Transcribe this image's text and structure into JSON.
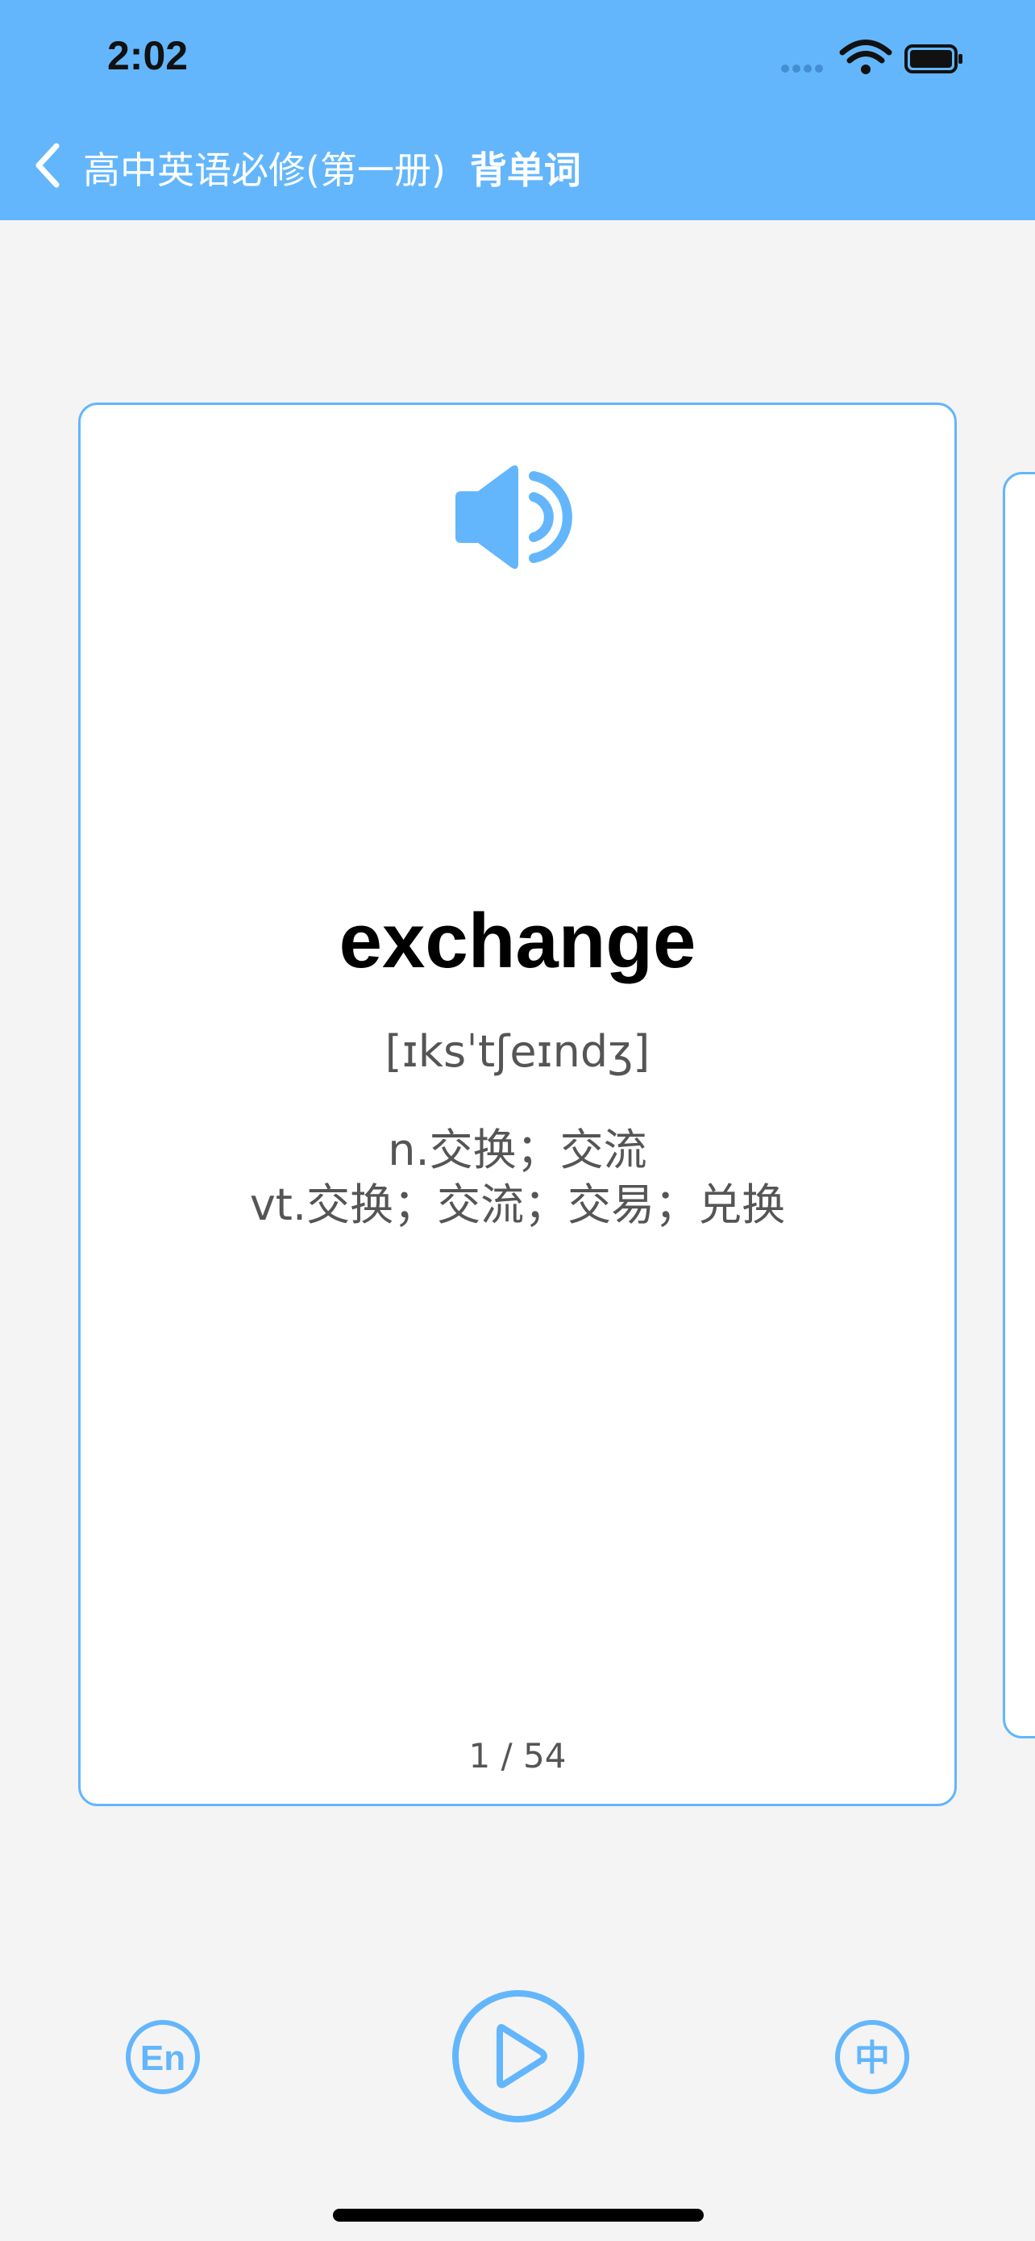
{
  "status_bar": {
    "time": "2:02"
  },
  "nav": {
    "back_icon": "chevron-left-icon",
    "subtitle": "高中英语必修(第一册)",
    "title": "背单词"
  },
  "card": {
    "speaker_icon": "speaker-icon",
    "word": "exchange",
    "phonetic": "[ɪksˈtʃeɪndʒ]",
    "meanings": [
      "n.交换；交流",
      "vt.交换；交流；交易；兑换"
    ],
    "counter": "1 / 54"
  },
  "controls": {
    "en_label": "En",
    "play_icon": "play-icon",
    "zh_label": "中"
  },
  "colors": {
    "accent": "#63b6fc",
    "background": "#f4f4f4"
  }
}
